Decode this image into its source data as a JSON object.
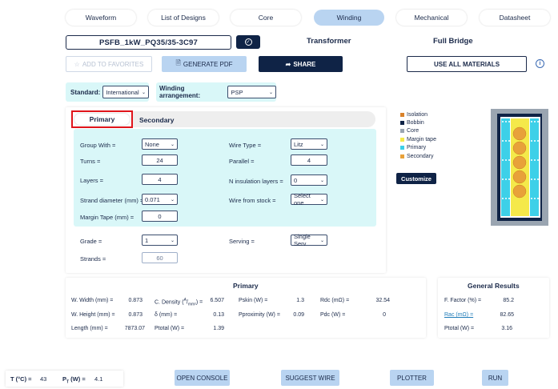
{
  "nav_tabs": [
    {
      "label": "Waveform"
    },
    {
      "label": "List of Designs"
    },
    {
      "label": "Core"
    },
    {
      "label": "Winding"
    },
    {
      "label": "Mechanical"
    },
    {
      "label": "Datasheet"
    }
  ],
  "active_tab": "Winding",
  "design_name": "PSFB_1kW_PQ35/35-3C97",
  "header": {
    "type": "Transformer",
    "topology": "Full Bridge"
  },
  "toolbar": {
    "favorites_label": "ADD TO FAVORITES",
    "pdf_label": "GENERATE PDF",
    "share_label": "SHARE",
    "all_materials_label": "USE ALL MATERIALS",
    "info_glyph": "i"
  },
  "standard": {
    "label": "Standard:",
    "value": "International"
  },
  "winding_arrangement": {
    "label": "Winding arrangement:",
    "value": "PSP"
  },
  "subtabs": {
    "primary": "Primary",
    "secondary": "Secondary"
  },
  "form": {
    "group_with": {
      "label": "Group With =",
      "value": "None"
    },
    "turns": {
      "label": "Turns =",
      "value": "24"
    },
    "layers": {
      "label": "Layers =",
      "value": "4"
    },
    "strand_diameter": {
      "label": "Strand diameter (mm) =",
      "value": "0.071"
    },
    "margin_tape": {
      "label": "Margin Tape (mm) =",
      "value": "0"
    },
    "wire_type": {
      "label": "Wire Type =",
      "value": "Litz"
    },
    "parallel": {
      "label": "Parallel =",
      "value": "4"
    },
    "n_insulation_layers": {
      "label": "N insulation layers =",
      "value": "0"
    },
    "wire_from_stock": {
      "label": "Wire from stock =",
      "value": "Select one"
    },
    "grade": {
      "label": "Grade =",
      "value": "1"
    },
    "strands": {
      "label": "Strands =",
      "value": "60"
    },
    "serving": {
      "label": "Serving =",
      "value": "Single Serv"
    }
  },
  "legend": [
    {
      "label": "Isolation",
      "color": "#d9822b"
    },
    {
      "label": "Bobbin",
      "color": "#0f2346"
    },
    {
      "label": "Core",
      "color": "#9aa5b1"
    },
    {
      "label": "Margin tape",
      "color": "#f5e94a"
    },
    {
      "label": "Primary",
      "color": "#3dd0e8"
    },
    {
      "label": "Secondary",
      "color": "#e8a13a"
    }
  ],
  "customize_label": "Customize",
  "primary_results": {
    "title": "Primary",
    "rows": [
      [
        {
          "label": "W. Width (mm) =",
          "value": "0.873"
        },
        {
          "label": "C. Density (A/mm²) =",
          "value": "6.507"
        },
        {
          "label": "Pskin (W) =",
          "value": "1.3"
        },
        {
          "label": "Rdc (mΩ) =",
          "value": "32.54"
        }
      ],
      [
        {
          "label": "W. Height (mm) =",
          "value": "0.873"
        },
        {
          "label": "δ (mm) =",
          "value": "0.13"
        },
        {
          "label": "Pproximity (W) =",
          "value": "0.09"
        },
        {
          "label": "Pdc (W) =",
          "value": "0"
        }
      ],
      [
        {
          "label": "Length (mm) =",
          "value": "7873.07"
        },
        {
          "label": "Ptotal (W) =",
          "value": "1.39"
        }
      ]
    ]
  },
  "general_results": {
    "title": "General Results",
    "rows": [
      {
        "label": "F. Factor (%) =",
        "value": "85.2"
      },
      {
        "label": "Rac (mΩ) =",
        "value": "82.65"
      },
      {
        "label": "Ptotal (W) =",
        "value": "3.16"
      }
    ]
  },
  "footer": {
    "temp_label": "T (°C) =",
    "temp_value": "43",
    "pt_label": "PT (W) =",
    "pt_value": "4.1",
    "buttons": [
      "OPEN CONSOLE",
      "SUGGEST WIRE",
      "PLOTTER",
      "RUN"
    ]
  }
}
